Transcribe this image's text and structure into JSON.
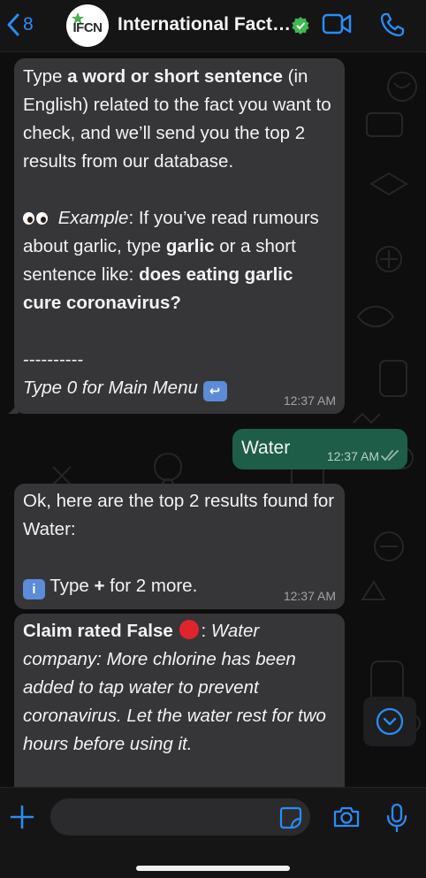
{
  "header": {
    "back_count": "8",
    "avatar_text": "IFCN",
    "contact_name": "International Fact…"
  },
  "messages": {
    "intro": {
      "p1_a": "Type ",
      "p1_b": "a word or short sentence",
      "p1_c": " (in English) related to the fact you want to check, and we’ll send you the top 2 results from our database.",
      "example_label": "Example",
      "p2_a": ":  If you’ve read rumours about garlic, type ",
      "p2_b": "garlic",
      "p2_c": " or a short sentence like: ",
      "p2_d": "does eating garlic cure coronavirus?",
      "divider": "----------",
      "menu_hint": "Type 0 for Main Menu",
      "time": "12:37 AM"
    },
    "user": {
      "text": "Water",
      "time": "12:37 AM"
    },
    "results": {
      "line1": "Ok, here are the top 2 results found for Water:",
      "info_a": "Type ",
      "info_b": "+",
      "info_c": " for 2 more.",
      "time": "12:37 AM"
    },
    "claim": {
      "label_a": "Claim rated False",
      "label_b": ":",
      "text": "Water company: More chlorine has been added to tap water to prevent coronavirus. Let the water rest for two hours before using it."
    }
  },
  "composer": {
    "placeholder": ""
  },
  "colors": {
    "accent": "#2a8cf6",
    "sent_bubble": "#1e5d48",
    "received_bubble": "#363638",
    "verified": "#3fb950"
  }
}
